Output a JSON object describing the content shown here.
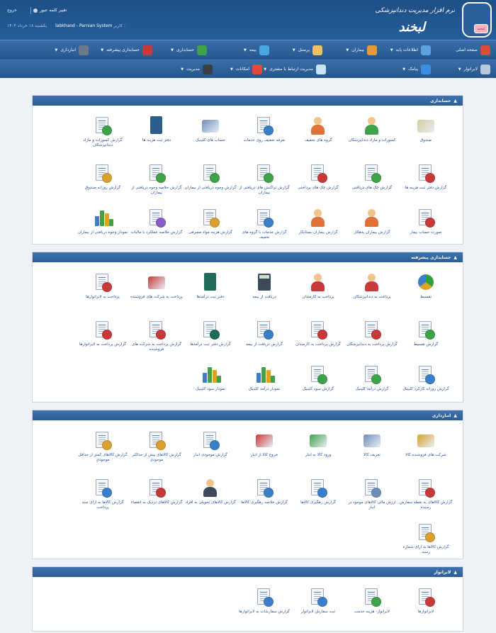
{
  "header": {
    "app_title": "نرم افزار مدیریت دندانپزشکی",
    "brand": "لبخند",
    "logo_badge": "لبخند",
    "change_password": "تغییر کلمه عبور",
    "logout": "خروج",
    "date": "یکشنبه ۱۸ خرداد ۱۴۰۴",
    "user_label": "کاربر :",
    "user_value": "labkhand - Parnian System"
  },
  "nav_row1": [
    {
      "label": "صفحه اصلی",
      "icon": "home-icon",
      "color": "#d94b3a"
    },
    {
      "label": "اطلاعات پایه",
      "icon": "info-icon",
      "color": "#5aa3e0",
      "caret": "▼"
    },
    {
      "label": "بیماران",
      "icon": "patient-icon",
      "color": "#e39a3c",
      "caret": "▼"
    },
    {
      "label": "پرسنل",
      "icon": "staff-icon",
      "color": "#f0c060",
      "caret": "▼"
    },
    {
      "label": "بیمه",
      "icon": "insurance-icon",
      "color": "#48a8df",
      "caret": "▼"
    },
    {
      "label": "حسابداری",
      "icon": "accounting-icon",
      "color": "#3ea348",
      "caret": "▼"
    },
    {
      "label": "حسابداری پیشرفته",
      "icon": "advanced-accounting-icon",
      "color": "#c83a3a",
      "caret": "▼"
    },
    {
      "label": "انبارداری",
      "icon": "warehouse-icon",
      "color": "#6b7a88",
      "caret": "▼"
    }
  ],
  "nav_row2": [
    {
      "label": "لابراتوار",
      "icon": "lab-icon",
      "color": "#b8c9de",
      "caret": "▼"
    },
    {
      "label": "پیامک",
      "icon": "sms-icon",
      "color": "#3a8fe0",
      "caret": "▼"
    },
    {
      "label": "مدیریت ارتباط با مشتری",
      "icon": "crm-icon",
      "color": "#c9e4f2",
      "caret": "▼"
    },
    {
      "label": "امکانات",
      "icon": "tools-icon",
      "color": "#e04a3a",
      "caret": "▼"
    },
    {
      "label": "مدیریت",
      "icon": "admin-icon",
      "color": "#3a3f48",
      "caret": "▼"
    }
  ],
  "panels": [
    {
      "title": "حسابداری",
      "toggle": "▲",
      "items": [
        "صندوق",
        "کسورات و مازاد دندانپزشکان",
        "گروه های تخفیف",
        "تعرفه تخفیف روی خدمات",
        "حساب های کلینیک",
        "دفتر ثبت هزینه ها",
        "گزارش کسورات و مازاد دندانپزشکان",
        "گزارش دفتر ثبت هزینه ها",
        "گزارش چک های دریافتی",
        "گزارش چک های پرداختی",
        "گزارش تراکنش های دریافتی از بیماران",
        "گزارش وجوه دریافتی از بیماران",
        "گزارش خلاصه وجوه دریافتی از بیماران",
        "گزارش روزانه صندوق",
        "صورت حساب بیمار",
        "گزارش بیماران بدهکار",
        "گزارش بیماران بستانکار",
        "گزارش خدمات با گروه های تخفیف",
        "گزارش هزینه مواد مصرفی",
        "گزارش خلاصه عملکرد با مالیات",
        "نمودار وجوه دریافتی از بیماران"
      ]
    },
    {
      "title": "حسابداری پیشرفته",
      "toggle": "▲",
      "items": [
        "تقسیط",
        "پرداخت به دندانپزشکان",
        "پرداخت به کارمندان",
        "دریافت از بیمه",
        "دفتر ثبت درآمدها",
        "پرداخت به شرکت های فروشنده",
        "پرداخت به لابراتوارها",
        "گزارش تقسیط",
        "گزارش پرداخت به دندانپزشکان",
        "گزارش پرداخت به کارمندان",
        "گزارش دریافت از بیمه",
        "گزارش دفتر ثبت درآمدها",
        "گزارش پرداخت به شرکت های فروشنده",
        "گزارش پرداخت به لابراتوارها",
        "گزارش روزانه کارکرد کلینیک",
        "گزارش درآمد کلینیک",
        "گزارش سود کلینیک",
        "نمودار درآمد کلینیک",
        "نمودار سود کلینیک"
      ]
    },
    {
      "title": "انبارداری",
      "toggle": "▲",
      "items": [
        "شرکت های فروشنده کالا",
        "تعریف کالا",
        "ورود کالا به انبار",
        "خروج کالا از انبار",
        "گزارش موجودی انبار",
        "گزارش کالاهای بیش از حداکثر موجودی",
        "گزارش کالاهای کمتر از حداقل موجودی",
        "گزارش کالاهای به نقطه سفارش رسیده",
        "ارزش مالی کالاهای موجود در انبار",
        "گزارش رهگیری کالاها",
        "گزارش خلاصه رهگیری کالاها",
        "گزارش کالاهای تحویلی به افراد",
        "گزارش کالاهای نزدیک به انقضاء",
        "گزارش کالاها به ازای سند پرداخت",
        "گزارش کالاها به ازای شماره رسید"
      ]
    },
    {
      "title": "لابراتوار",
      "toggle": "▲",
      "items": [
        "لابراتوارها",
        "لابراتوار- هزینه خدمت",
        "ثبت سفارش لابراتوار",
        "گزارش سفارشات به لابراتوارها"
      ]
    }
  ]
}
